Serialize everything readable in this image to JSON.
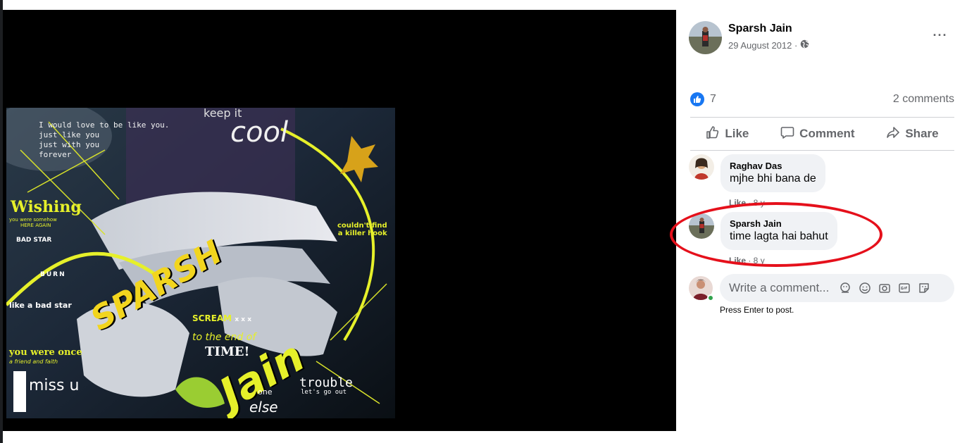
{
  "post": {
    "author": "Sparsh Jain",
    "date": "29 August 2012 ·",
    "privacy_icon": "globe-icon",
    "more_label": "···"
  },
  "photo_text": {
    "line1": "I would love to be like you.",
    "line2": "just like you",
    "line3": "just with you",
    "line4": "forever",
    "keep_it": "keep it",
    "cool": "cool",
    "wishing": "Wishing",
    "wishing_sub1": "you were somehow",
    "wishing_sub2": "HERE AGAIN",
    "bad_star": "BAD STAR",
    "burn": "BURN",
    "like_bad_star": "like a bad star",
    "couldnt1": "couldn't find",
    "couldnt2": "a killer hook",
    "sparsh": "SPARSH",
    "scream": "SCREAM",
    "scream_x": "x x x",
    "end_of_time1": "to the end of",
    "end_of_time2": "TIME!",
    "jain": "Jain",
    "you_were_once": "you were once",
    "friend_and_faith": "a friend and faith",
    "miss_u": "miss u",
    "trouble": "trouble",
    "lets_go_out": "let's go out",
    "one": "one",
    "else": "else"
  },
  "reactions": {
    "like_count": "7",
    "comments_label": "2 comments"
  },
  "actions": {
    "like": "Like",
    "comment": "Comment",
    "share": "Share"
  },
  "comments": [
    {
      "name": "Raghav Das",
      "text": "mjhe bhi bana de",
      "like": "Like",
      "meta": " · 8 y"
    },
    {
      "name": "Sparsh Jain",
      "text": "time lagta hai bahut",
      "like": "Like",
      "meta": " · 8 y"
    }
  ],
  "composer": {
    "placeholder": "Write a comment...",
    "hint": "Press Enter to post.",
    "icons": [
      "avatar-sticker-icon",
      "emoji-icon",
      "camera-icon",
      "gif-icon",
      "sticker-icon"
    ]
  },
  "colors": {
    "brand_blue": "#1877f2",
    "highlight_red": "#e5101b",
    "online_green": "#31a24c"
  }
}
